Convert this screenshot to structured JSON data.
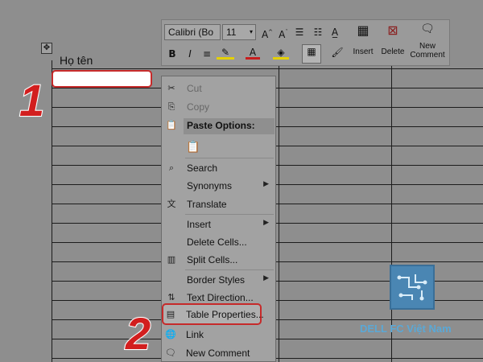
{
  "document": {
    "header_cell_text": "Họ tên",
    "move_handle_icon": "move-handle-icon"
  },
  "annotations": {
    "step1": "1",
    "step2": "2"
  },
  "mini_toolbar": {
    "font_name": "Calibri (Bo",
    "font_size": "11",
    "insert_label": "Insert",
    "delete_label": "Delete",
    "new_comment_label_line1": "New",
    "new_comment_label_line2": "Comment"
  },
  "context_menu": {
    "items": [
      {
        "label": "Cut",
        "icon": "scissors-icon",
        "disabled": true
      },
      {
        "label": "Copy",
        "icon": "copy-icon",
        "disabled": true
      },
      {
        "label": "Paste Options:",
        "icon": "paste-icon"
      },
      {
        "label": "",
        "icon": "clipboard-icon"
      },
      {
        "label": "Search",
        "icon": "search-icon"
      },
      {
        "label": "Synonyms",
        "icon": "",
        "submenu": true
      },
      {
        "label": "Translate",
        "icon": "translate-icon"
      },
      {
        "label": "Insert",
        "icon": "",
        "submenu": true
      },
      {
        "label": "Delete Cells...",
        "icon": ""
      },
      {
        "label": "Split Cells...",
        "icon": "split-cells-icon"
      },
      {
        "label": "Border Styles",
        "icon": "",
        "submenu": true
      },
      {
        "label": "Text Direction...",
        "icon": "text-direction-icon"
      },
      {
        "label": "Table Properties...",
        "icon": "table-properties-icon"
      },
      {
        "label": "Link",
        "icon": "link-icon"
      },
      {
        "label": "New Comment",
        "icon": "comment-icon"
      }
    ]
  },
  "watermark": {
    "text": "DELL FC Việt Nam"
  }
}
